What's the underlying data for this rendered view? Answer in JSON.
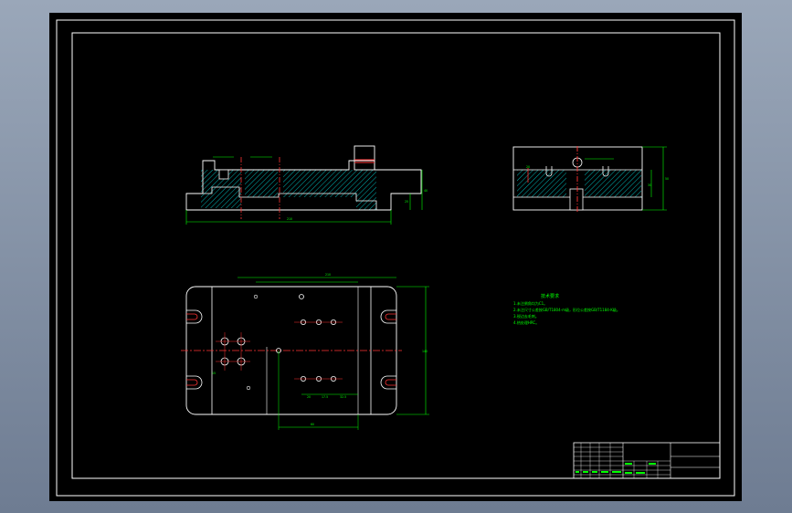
{
  "drawing": {
    "colors": {
      "background": "#000000",
      "frame": "#ffffff",
      "dimension": "#00ff00",
      "centerline": "#ff0000",
      "hatch": "#00ffff",
      "window_gradient_top": "#9aa7b9",
      "window_gradient_bottom": "#6e7c92"
    },
    "technical_requirements": {
      "title": "技术要求",
      "lines": [
        "1.未注倒角均为C1。",
        "2.未注尺寸公差按GB/T1804-m级，形位公差按GB/T1184-K级。",
        "3.锐边去毛刺。",
        "4.热处理HRC。"
      ]
    },
    "front_view_dims": {
      "overall_width": "210",
      "left_height": "25",
      "right_height": "40"
    },
    "side_view_dims": {
      "overall_height": "50",
      "step_height": "30",
      "slot": "20"
    },
    "plan_view_dims": {
      "overall_length": "210",
      "overall_width": "140",
      "bottom_width": "60",
      "spacing_a": "20",
      "spacing_b": "17.5",
      "spacing_c": "32.5",
      "hole_spacing": "15"
    }
  }
}
